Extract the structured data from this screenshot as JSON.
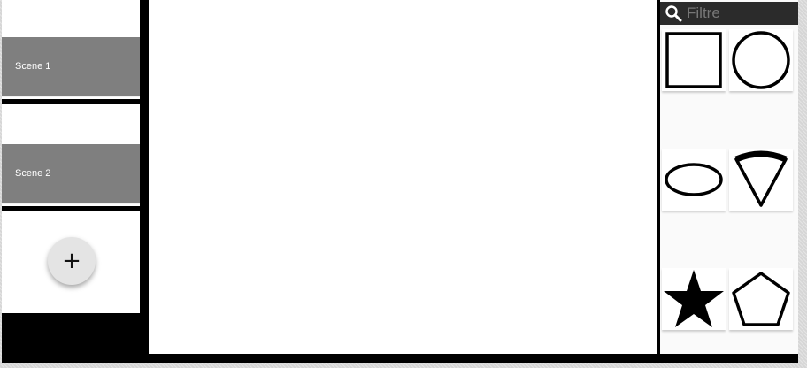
{
  "scenes": {
    "items": [
      {
        "label": "Scene 1"
      },
      {
        "label": "Scene 2"
      }
    ],
    "add_label": "+"
  },
  "shapes_panel": {
    "search": {
      "placeholder": "Filtre"
    },
    "shapes": [
      {
        "name": "square",
        "icon": "square-icon"
      },
      {
        "name": "circle",
        "icon": "circle-icon"
      },
      {
        "name": "ellipse",
        "icon": "ellipse-icon"
      },
      {
        "name": "pie-wedge",
        "icon": "wedge-icon"
      },
      {
        "name": "star",
        "icon": "star-icon"
      },
      {
        "name": "pentagon",
        "icon": "pentagon-icon"
      }
    ]
  },
  "colors": {
    "scene_item_bg": "#7f7f7f",
    "search_bg": "#2b2b2b",
    "canvas_bg": "#ffffff"
  }
}
